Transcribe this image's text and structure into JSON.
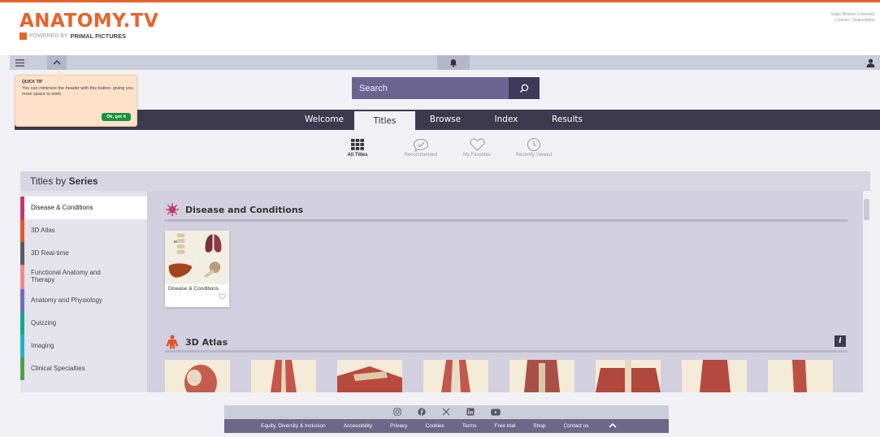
{
  "brand": {
    "title": "ANATOMY.TV",
    "powered_by": "POWERED BY",
    "company": "PRIMAL PICTURES"
  },
  "license": {
    "line1": "Sogle Blomen University",
    "line2": "License / Subscription"
  },
  "search": {
    "placeholder": "Search"
  },
  "quick_tip": {
    "title": "QUICK TIP",
    "text": "You can minimize the header with this button, giving you more space to work.",
    "button": "Ok, got it"
  },
  "nav": {
    "tabs": [
      {
        "label": "Welcome"
      },
      {
        "label": "Titles"
      },
      {
        "label": "Browse"
      },
      {
        "label": "Index"
      },
      {
        "label": "Results"
      }
    ],
    "active": "Titles"
  },
  "subnav": [
    {
      "label": "All Titles",
      "icon": "grid-icon"
    },
    {
      "label": "Recommended",
      "icon": "check-bubble-icon"
    },
    {
      "label": "My Favorites",
      "icon": "heart-icon"
    },
    {
      "label": "Recently Viewed",
      "icon": "clock-icon"
    }
  ],
  "series": {
    "header_prefix": "Titles by",
    "header_bold": "Series",
    "items": [
      {
        "label": "Disease & Conditions",
        "color": "#c0396b"
      },
      {
        "label": "3D Atlas",
        "color": "#e3552f"
      },
      {
        "label": "3D Real-time",
        "color": "#5a5a66"
      },
      {
        "label": "Functional Anatomy and Therapy",
        "color": "#f08a8a"
      },
      {
        "label": "Anatomy and Physiology",
        "color": "#6c6fbf"
      },
      {
        "label": "Quizzing",
        "color": "#1aa68f"
      },
      {
        "label": "Imaging",
        "color": "#22b3c4"
      },
      {
        "label": "Clinical Specialties",
        "color": "#4ba24a"
      }
    ]
  },
  "sections": {
    "disease": {
      "title": "Disease and Conditions",
      "card_label": "Disease & Conditions"
    },
    "atlas": {
      "title": "3D Atlas",
      "info_label": "i"
    }
  },
  "footer": {
    "icons": [
      "instagram-icon",
      "facebook-icon",
      "x-icon",
      "linkedin-icon",
      "youtube-icon"
    ],
    "links": [
      "Equity, Diversity & Inclusion",
      "Accessibility",
      "Privacy",
      "Cookies",
      "Terms",
      "Free trial",
      "Shop",
      "Contact us"
    ]
  },
  "colors": {
    "brand_orange": "#e8632b",
    "nav_dark": "#3d3a4f",
    "search_purple": "#6c6490",
    "ok_green": "#17933f"
  }
}
